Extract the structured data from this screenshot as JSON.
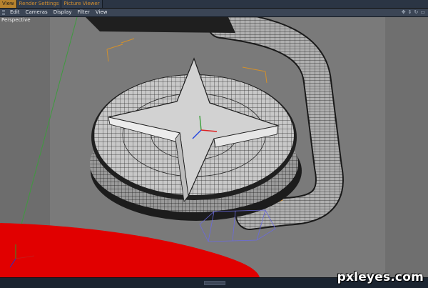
{
  "tabs": [
    {
      "label": "View",
      "active": true
    },
    {
      "label": "Render Settings",
      "active": false
    },
    {
      "label": "Picture Viewer",
      "active": false
    }
  ],
  "menu": [
    "Edit",
    "Cameras",
    "Display",
    "Filter",
    "View"
  ],
  "nav_icons": [
    "move-icon",
    "zoom-icon",
    "rotate-icon",
    "maximize-icon"
  ],
  "viewport": {
    "label": "Perspective"
  },
  "watermark": "pxleyes.com",
  "colors": {
    "viewport_bg": "#7a7a7a",
    "active_tab": "#b8832e",
    "selection_box": "#d4902a",
    "red_object": "#e10000"
  }
}
